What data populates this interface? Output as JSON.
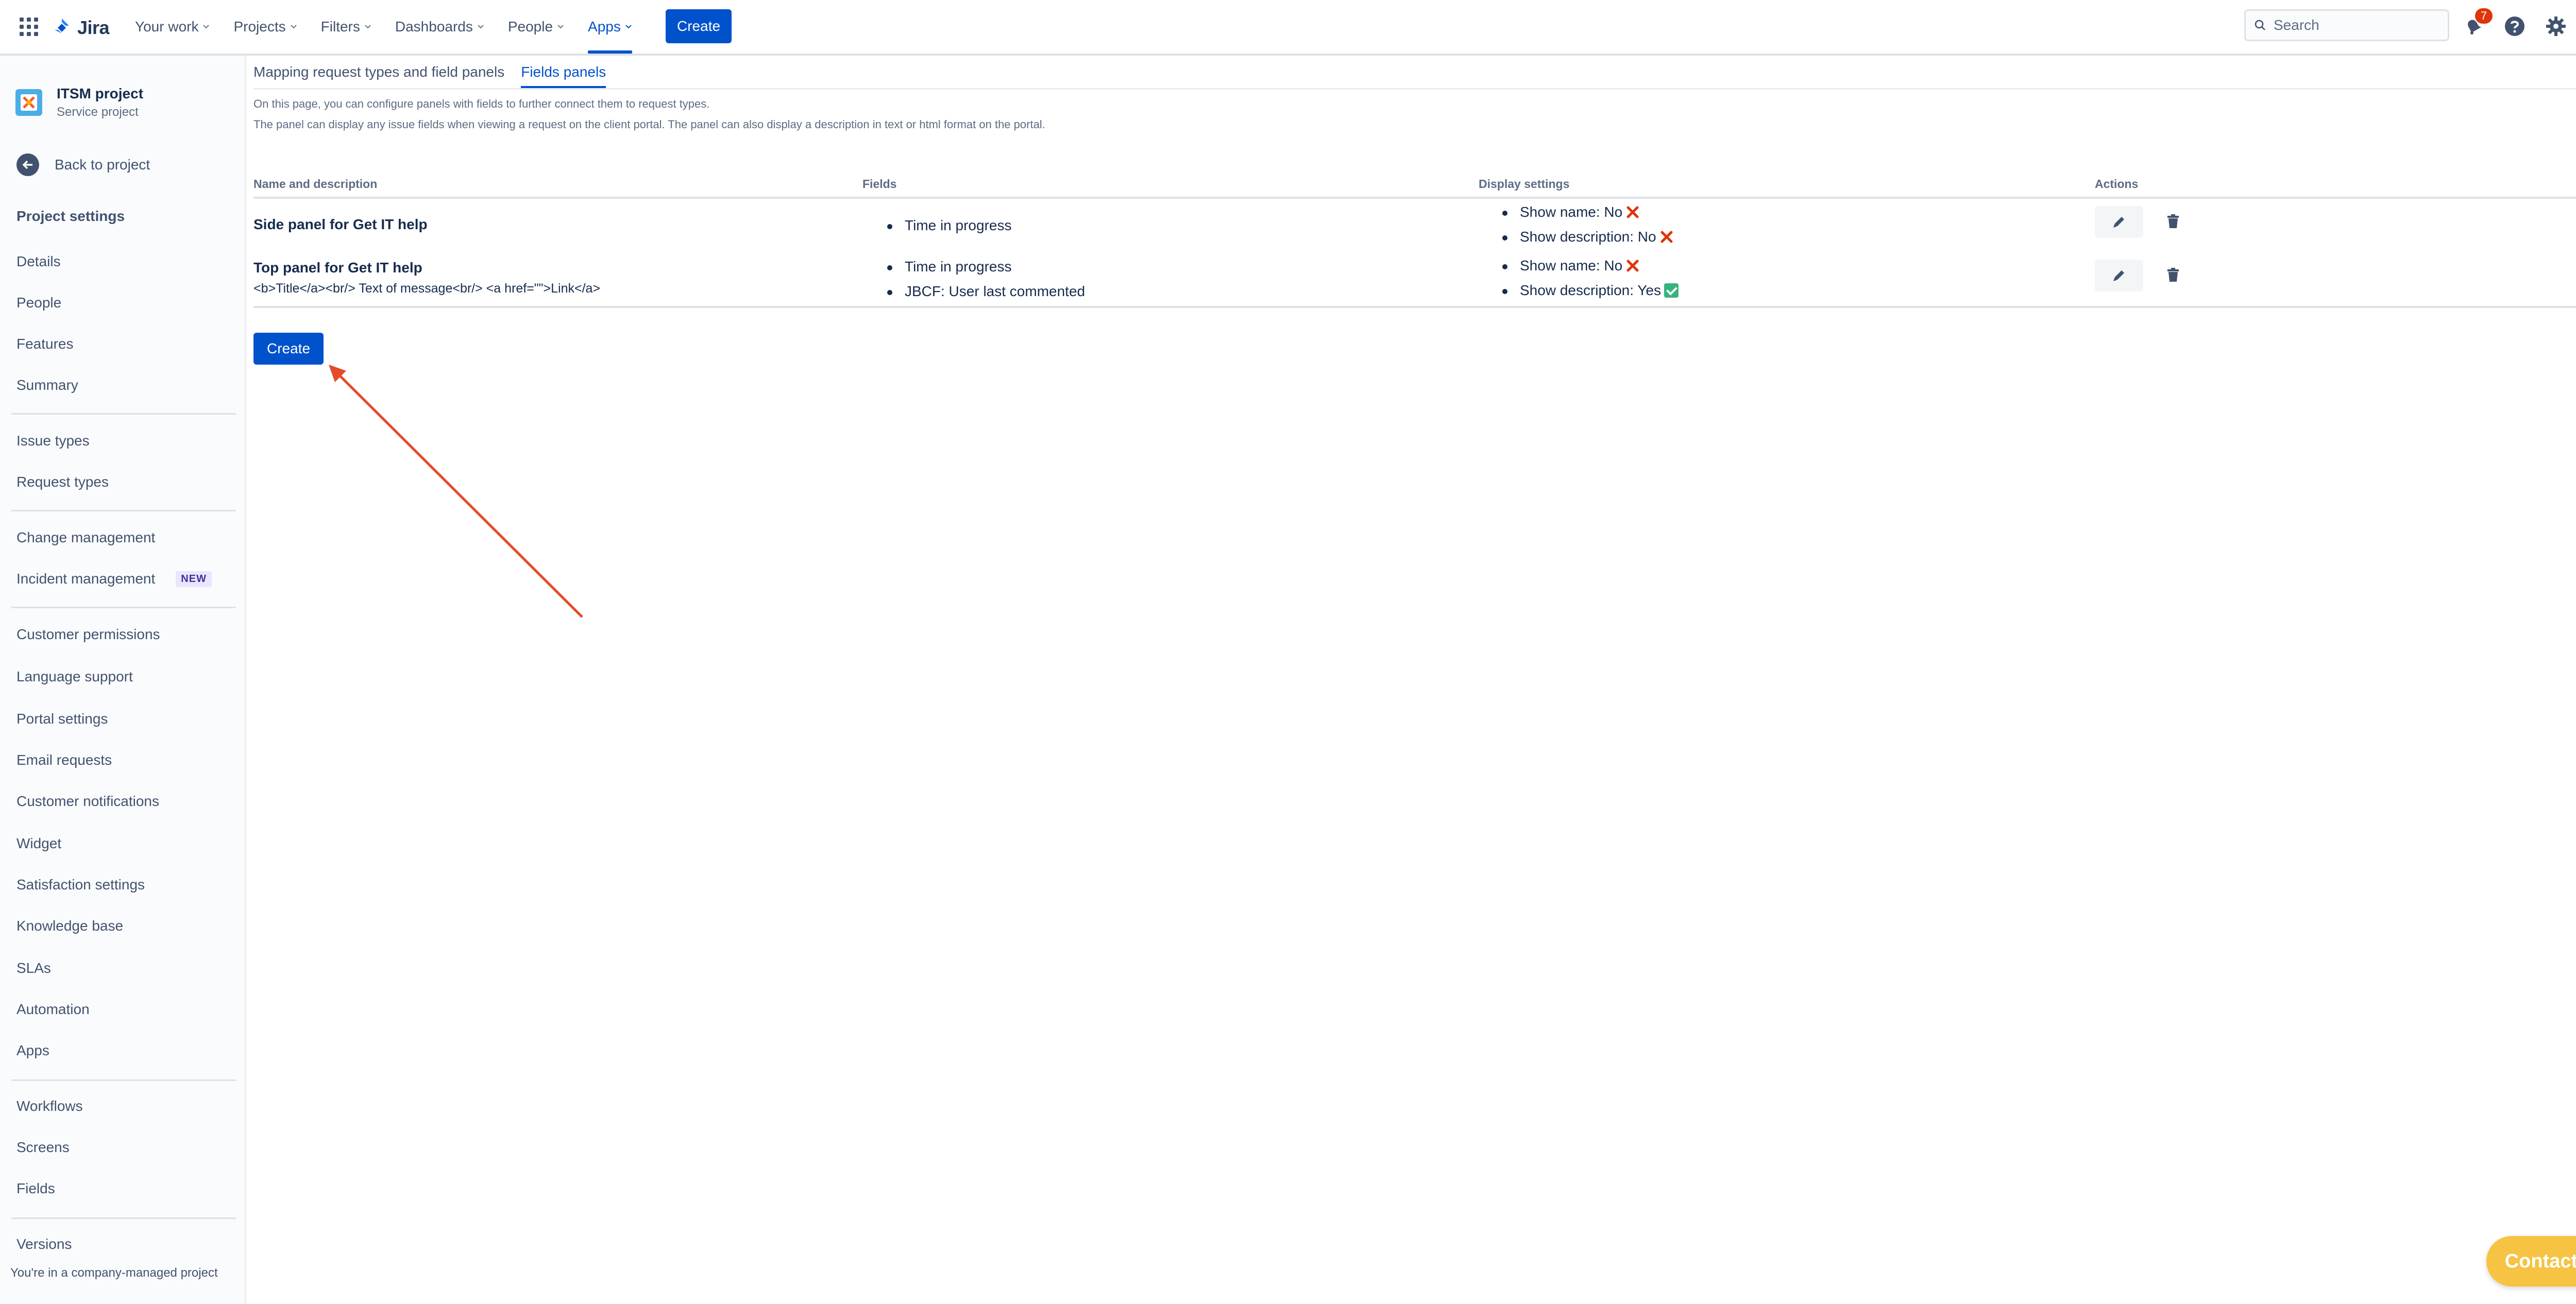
{
  "app": {
    "name": "Jira"
  },
  "nav": {
    "items": [
      {
        "label": "Your work"
      },
      {
        "label": "Projects"
      },
      {
        "label": "Filters"
      },
      {
        "label": "Dashboards"
      },
      {
        "label": "People"
      },
      {
        "label": "Apps"
      }
    ],
    "active": "Apps",
    "create_label": "Create",
    "search_placeholder": "Search",
    "notification_count": "7"
  },
  "sidebar": {
    "project_name": "ITSM project",
    "project_type": "Service project",
    "back_label": "Back to project",
    "section_title": "Project settings",
    "groups": [
      [
        "Details",
        "People",
        "Features",
        "Summary"
      ],
      [
        "Issue types",
        "Request types"
      ],
      [
        "Change management",
        "Incident management"
      ],
      [
        "Customer permissions",
        "Language support",
        "Portal settings",
        "Email requests",
        "Customer notifications",
        "Widget",
        "Satisfaction settings",
        "Knowledge base",
        "SLAs",
        "Automation",
        "Apps"
      ],
      [
        "Workflows",
        "Screens",
        "Fields"
      ],
      [
        "Versions"
      ]
    ],
    "new_badge": "NEW",
    "footer": "You're in a company-managed project"
  },
  "main": {
    "tabs": [
      {
        "label": "Mapping request types and field panels"
      },
      {
        "label": "Fields panels"
      }
    ],
    "active_tab": "Fields panels",
    "description_line1": "On this page, you can configure panels with fields to further connect them to request types.",
    "description_line2": "The panel can display any issue fields when viewing a request on the client portal. The panel can also display a description in text or html format on the portal.",
    "table": {
      "headers": [
        "Name and description",
        "Fields",
        "Display settings",
        "Actions"
      ],
      "rows": [
        {
          "name": "Side panel for Get IT help",
          "description": "",
          "fields": [
            "Time in progress"
          ],
          "settings": [
            "Show name: No",
            "Show description: No"
          ],
          "settings_status": [
            "no",
            "no"
          ]
        },
        {
          "name": "Top panel for Get IT help",
          "description": "<b>Title</a><br/> Text of message<br/> <a href=\"\">Link</a>",
          "fields": [
            "Time in progress",
            "JBCF: User last commented"
          ],
          "settings": [
            "Show name: No",
            "Show description: Yes"
          ],
          "settings_status": [
            "no",
            "yes"
          ]
        }
      ]
    },
    "create_label": "Create"
  },
  "contact_label": "Contact Us",
  "colors": {
    "primary": "#0052CC",
    "text": "#172B4D",
    "subtle": "#5E6C84",
    "contact": "#F6C342",
    "annotation_arrow": "#E34B2B"
  }
}
